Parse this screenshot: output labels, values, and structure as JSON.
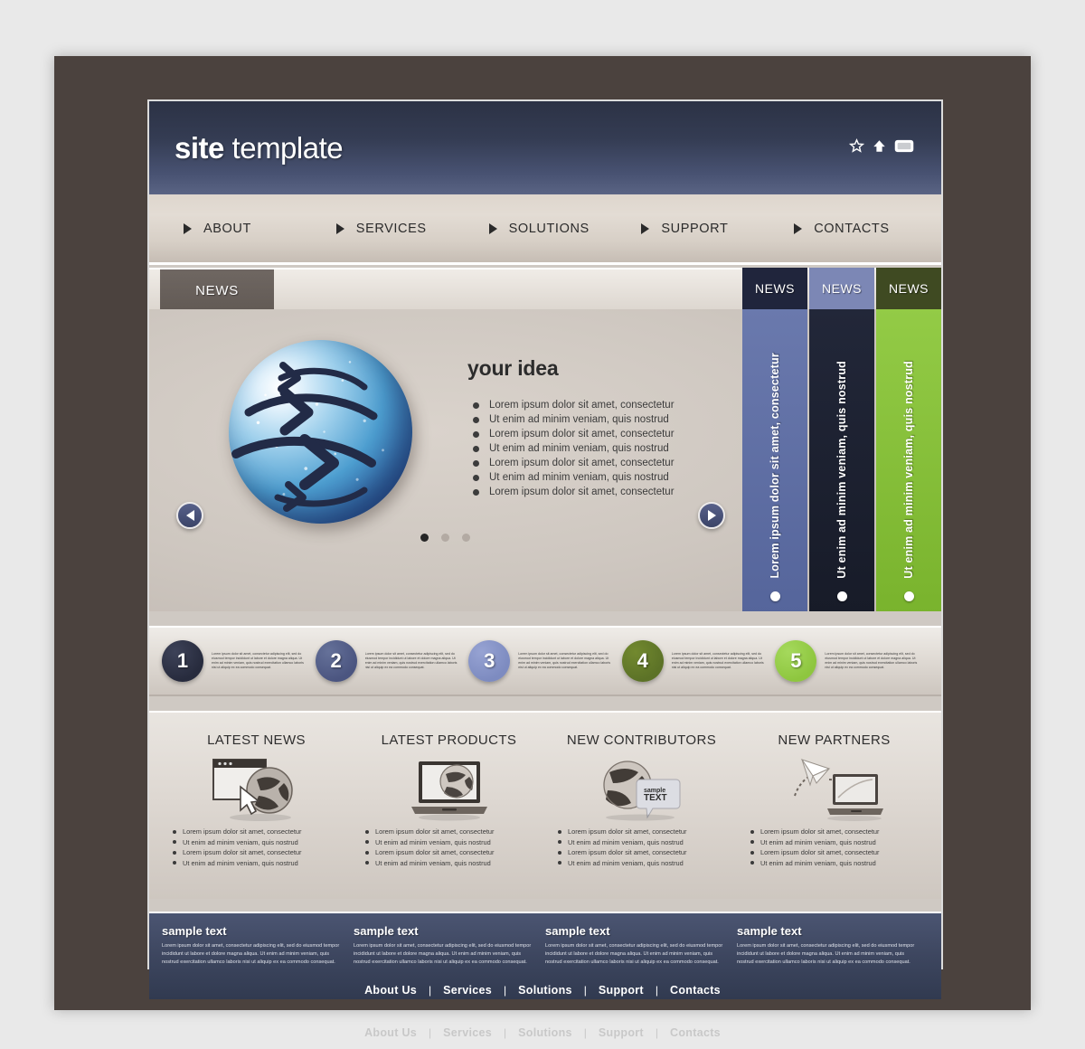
{
  "brand": {
    "name_bold": "site",
    "name_light": " template"
  },
  "header": {
    "icons": [
      {
        "name": "star-icon",
        "glyph": "star"
      },
      {
        "name": "home-icon",
        "glyph": "home"
      },
      {
        "name": "window-icon",
        "glyph": "window"
      }
    ]
  },
  "nav": {
    "items": [
      {
        "label": "ABOUT"
      },
      {
        "label": "SERVICES"
      },
      {
        "label": "SOLUTIONS"
      },
      {
        "label": "SUPPORT"
      },
      {
        "label": "CONTACTS"
      }
    ]
  },
  "hero": {
    "tab_label": "NEWS",
    "title": "your idea",
    "bullets": [
      "Lorem ipsum dolor sit amet, consectetur",
      "Ut enim ad minim veniam, quis nostrud",
      "Lorem ipsum dolor sit amet, consectetur",
      "Ut enim ad minim veniam, quis nostrud",
      "Lorem ipsum dolor sit amet, consectetur",
      "Ut enim ad minim veniam, quis nostrud",
      "Lorem ipsum dolor sit amet, consectetur"
    ],
    "prev_label": "Previous slide",
    "next_label": "Next slide",
    "dots": [
      {
        "active": true
      },
      {
        "active": false
      },
      {
        "active": false
      }
    ],
    "panels": [
      {
        "tab_label": "NEWS",
        "text": "Lorem ipsum dolor sit amet, consectetur",
        "tab_color": "#20253c",
        "body_color": "#6a79ad",
        "body_color2": "#55659b"
      },
      {
        "tab_label": "NEWS",
        "text": "Ut enim ad minim veniam, quis nostrud",
        "tab_color": "#7c87b5",
        "body_color": "#1e2333",
        "body_color2": "#171b28"
      },
      {
        "tab_label": "NEWS",
        "text": "Ut enim ad minim veniam, quis nostrud",
        "tab_color": "#3f4a22",
        "body_color": "#8cc63f",
        "body_color2": "#7ab52f"
      }
    ]
  },
  "steps": [
    {
      "number": "1",
      "color": "#272b3d",
      "text": "Lorem ipsum dolor sit amet, consectetur adipiscing elit, sed do eiusmod tempor incididunt ut labore et dolore magna aliqua. Ut enim ad minim veniam, quis nostrud exercitation ullamco laboris nisi ut aliquip ex ea commodo consequat."
    },
    {
      "number": "2",
      "color": "#4b5580",
      "text": "Lorem ipsum dolor sit amet, consectetur adipiscing elit, sed do eiusmod tempor incididunt ut labore et dolore magna aliqua. Ut enim ad minim veniam, quis nostrud exercitation ullamco laboris nisi ut aliquip ex ea commodo consequat."
    },
    {
      "number": "3",
      "color": "#7d8bc0",
      "text": "Lorem ipsum dolor sit amet, consectetur adipiscing elit, sed do eiusmod tempor incididunt ut labore et dolore magna aliqua. Ut enim ad minim veniam, quis nostrud exercitation ullamco laboris nisi ut aliquip ex ea commodo consequat."
    },
    {
      "number": "4",
      "color": "#5c7227",
      "text": "Lorem ipsum dolor sit amet, consectetur adipiscing elit, sed do eiusmod tempor incididunt ut labore et dolore magna aliqua. Ut enim ad minim veniam, quis nostrud exercitation ullamco laboris nisi ut aliquip ex ea commodo consequat."
    },
    {
      "number": "5",
      "color": "#8ec63f",
      "text": "Lorem ipsum dolor sit amet, consectetur adipiscing elit, sed do eiusmod tempor incididunt ut labore et dolore magna aliqua. Ut enim ad minim veniam, quis nostrud exercitation ullamco laboris nisi ut aliquip ex ea commodo consequat."
    }
  ],
  "features": [
    {
      "title": "LATEST NEWS",
      "icon": "browser-globe-cursor-icon",
      "bullets": [
        "Lorem ipsum dolor sit amet, consectetur",
        "Ut enim ad minim veniam, quis nostrud",
        "Lorem ipsum dolor sit amet, consectetur",
        "Ut enim ad minim veniam, quis nostrud"
      ]
    },
    {
      "title": "LATEST PRODUCTS",
      "icon": "laptop-globe-icon",
      "bullets": [
        "Lorem ipsum dolor sit amet, consectetur",
        "Ut enim ad minim veniam, quis nostrud",
        "Lorem ipsum dolor sit amet, consectetur",
        "Ut enim ad minim veniam, quis nostrud"
      ]
    },
    {
      "title": "NEW CONTRIBUTORS",
      "icon": "globe-speech-bubble-icon",
      "icon_text": "sample TEXT",
      "bullets": [
        "Lorem ipsum dolor sit amet, consectetur",
        "Ut enim ad minim veniam, quis nostrud",
        "Lorem ipsum dolor sit amet, consectetur",
        "Ut enim ad minim veniam, quis nostrud"
      ]
    },
    {
      "title": "NEW PARTNERS",
      "icon": "paper-plane-laptop-icon",
      "bullets": [
        "Lorem ipsum dolor sit amet, consectetur",
        "Ut enim ad minim veniam, quis nostrud",
        "Lorem ipsum dolor sit amet, consectetur",
        "Ut enim ad minim veniam, quis nostrud"
      ]
    }
  ],
  "footer_panels": [
    {
      "title": "sample text",
      "body": "Lorem ipsum dolor sit amet, consectetur adipiscing elit, sed do eiusmod tempor incididunt ut labore et dolore magna aliqua. Ut enim ad minim veniam, quis nostrud exercitation ullamco laboris nisi ut aliquip ex ea commodo consequat."
    },
    {
      "title": "sample text",
      "body": "Lorem ipsum dolor sit amet, consectetur adipiscing elit, sed do eiusmod tempor incididunt ut labore et dolore magna aliqua. Ut enim ad minim veniam, quis nostrud exercitation ullamco laboris nisi ut aliquip ex ea commodo consequat."
    },
    {
      "title": "sample text",
      "body": "Lorem ipsum dolor sit amet, consectetur adipiscing elit, sed do eiusmod tempor incididunt ut labore et dolore magna aliqua. Ut enim ad minim veniam, quis nostrud exercitation ullamco laboris nisi ut aliquip ex ea commodo consequat."
    },
    {
      "title": "sample text",
      "body": "Lorem ipsum dolor sit amet, consectetur adipiscing elit, sed do eiusmod tempor incididunt ut labore et dolore magna aliqua. Ut enim ad minim veniam, quis nostrud exercitation ullamco laboris nisi ut aliquip ex ea commodo consequat."
    }
  ],
  "footer_nav": {
    "items": [
      {
        "label": "About Us"
      },
      {
        "label": "Services"
      },
      {
        "label": "Solutions"
      },
      {
        "label": "Support"
      },
      {
        "label": "Contacts"
      }
    ],
    "separator": "|"
  },
  "colors": {
    "frame": "#4b423e",
    "page_bg": "#e9e9e9",
    "header_dark": "#2c3245",
    "accent_blue": "#4b5580",
    "accent_green": "#8ec63f"
  }
}
